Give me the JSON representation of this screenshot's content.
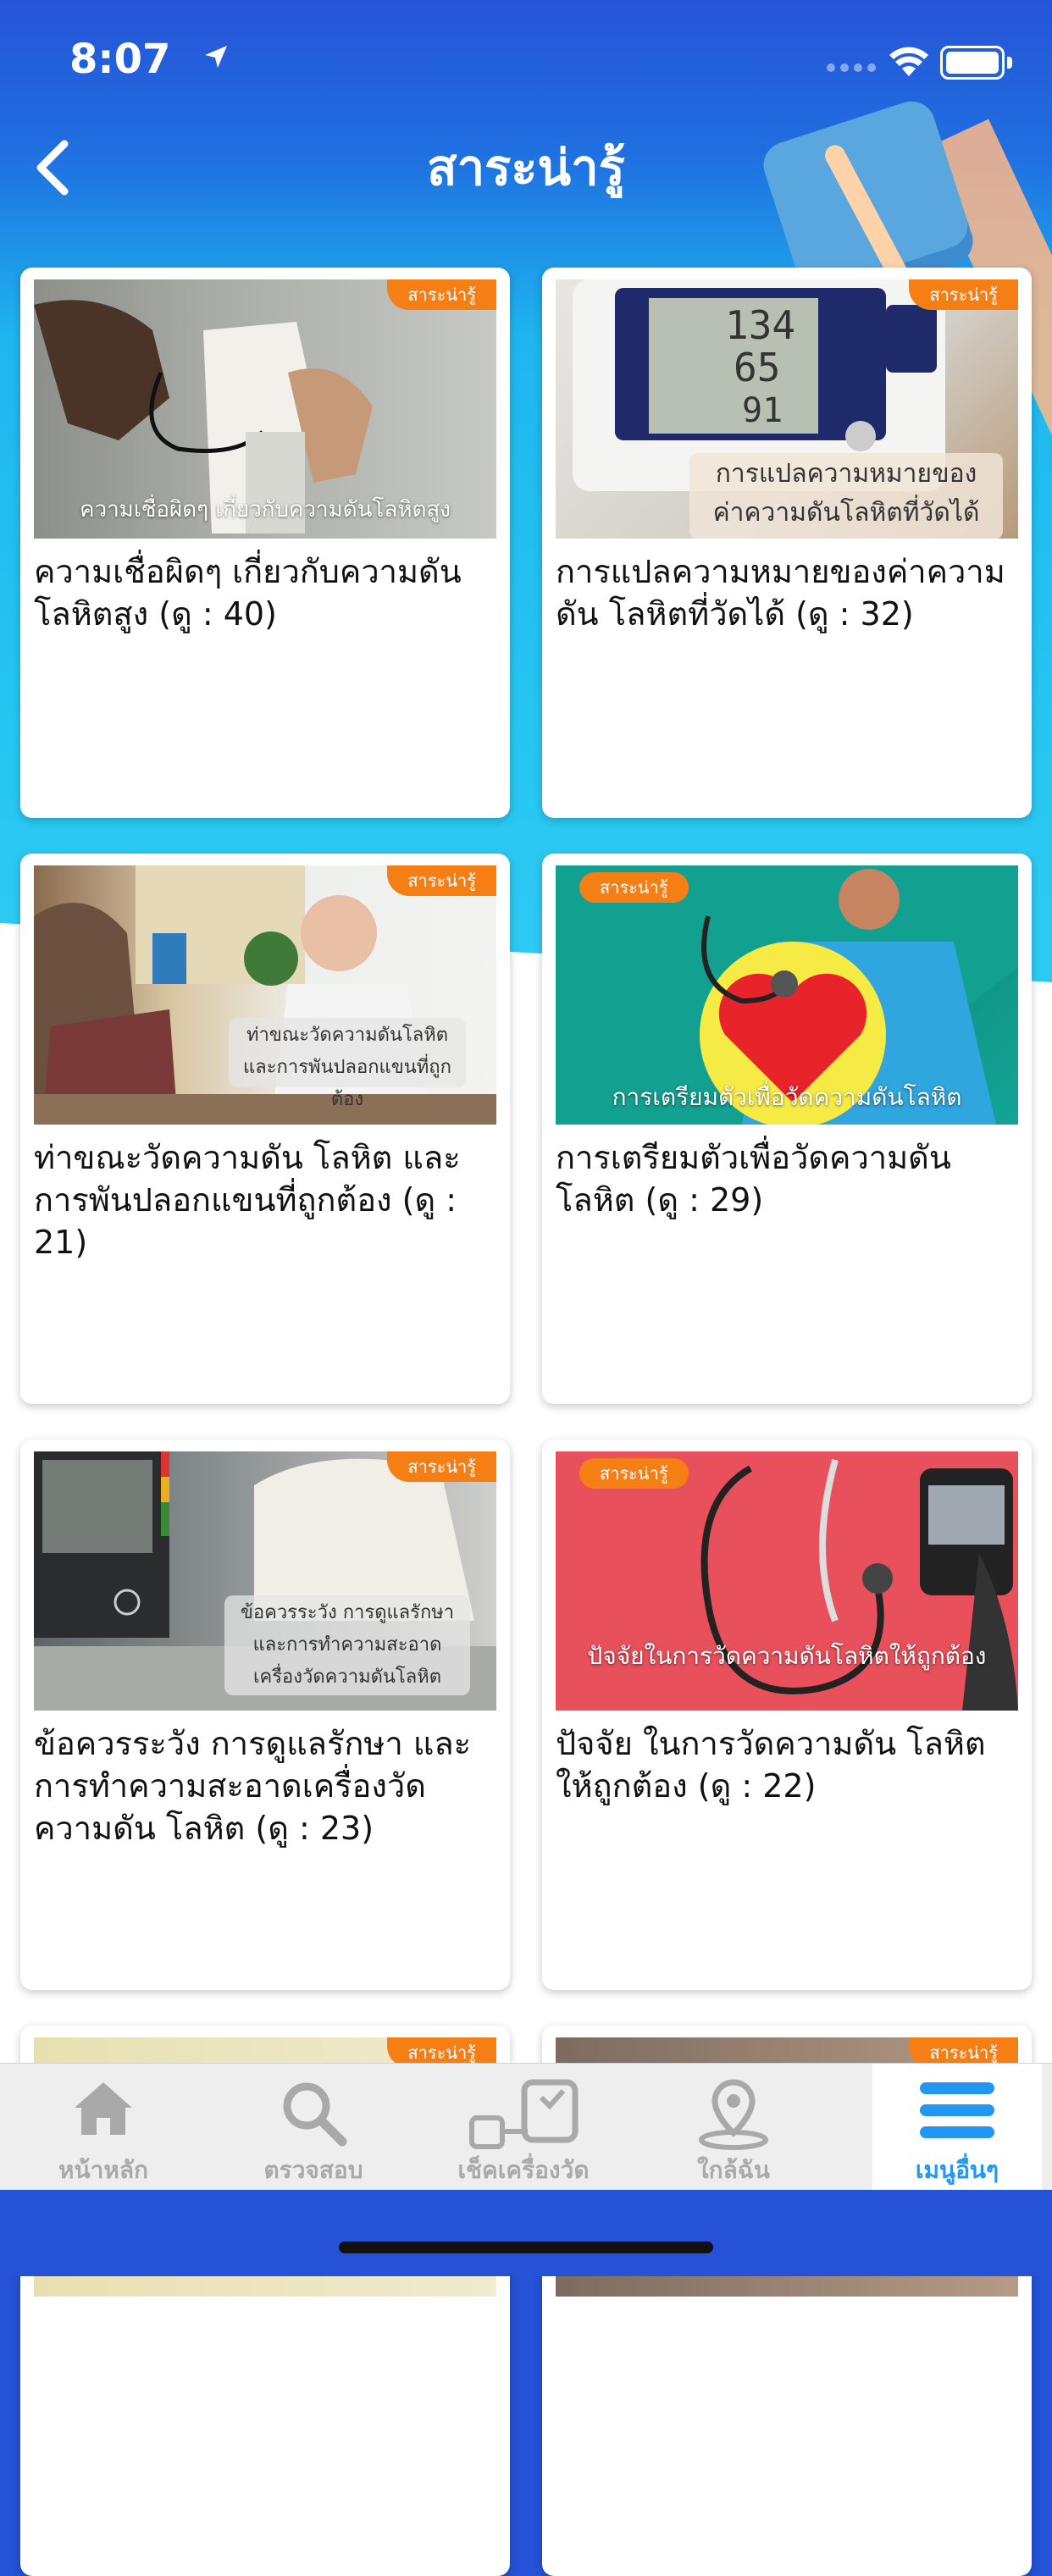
{
  "status_bar": {
    "time": "8:07"
  },
  "nav": {
    "title": "สาระน่ารู้"
  },
  "colors": {
    "header_blue": "#2552d6",
    "badge_orange": "#f57e15",
    "active_tab": "#2196f3"
  },
  "cards": [
    {
      "badge": "สาระน่ารู้",
      "image_text": "ความเชื่อผิดๆ เกี่ยวกับความดันโลหิตสูง",
      "title": "ความเชื่อผิดๆ เกี่ยวกับความดันโลหิตสูง (ดู : 40)"
    },
    {
      "badge": "สาระน่ารู้",
      "image_text_1": "การแปลความหมายของ",
      "image_text_2": "ค่าความดันโลหิตที่วัดได้",
      "title": "การแปลความหมายของค่าความดัน โลหิตที่วัดได้ (ดู : 32)"
    },
    {
      "badge": "สาระน่ารู้",
      "image_text_1": "ท่าขณะวัดความดันโลหิต",
      "image_text_2": "และการพันปลอกแขนที่ถูกต้อง",
      "title": "ท่าขณะวัดความดัน โลหิต และการพันปลอกแขนที่ถูกต้อง (ดู : 21)"
    },
    {
      "badge": "สาระน่ารู้",
      "image_text": "การเตรียมตัวเพื่อวัดความดันโลหิต",
      "title": "การเตรียมตัวเพื่อวัดความดัน โลหิต (ดู : 29)"
    },
    {
      "badge": "สาระน่ารู้",
      "image_text_1": "ข้อควรระวัง การดูแลรักษา",
      "image_text_2": "และการทำความสะอาด",
      "image_text_3": "เครื่องวัดความดันโลหิต",
      "title": "ข้อควรระวัง การดูแลรักษา และการทำความสะอาดเครื่องวัดความดัน โลหิต (ดู : 23)"
    },
    {
      "badge": "สาระน่ารู้",
      "image_text": "ปัจจัยในการวัดความดันโลหิตให้ถูกต้อง",
      "title": "ปัจจัย ในการวัดความดัน โลหิตให้ถูกต้อง (ดู : 22)"
    },
    {
      "badge": "สาระน่ารู้"
    },
    {
      "badge": "สาระน่ารู้"
    }
  ],
  "tabs": [
    {
      "label": "หน้าหลัก",
      "icon": "home-icon"
    },
    {
      "label": "ตรวจสอบ",
      "icon": "search-icon"
    },
    {
      "label": "เช็คเครื่องวัด",
      "icon": "blood-pressure-device-icon"
    },
    {
      "label": "ใกล้ฉัน",
      "icon": "location-pin-icon"
    },
    {
      "label": "เมนูอื่นๆ",
      "icon": "menu-icon",
      "active": true
    }
  ]
}
